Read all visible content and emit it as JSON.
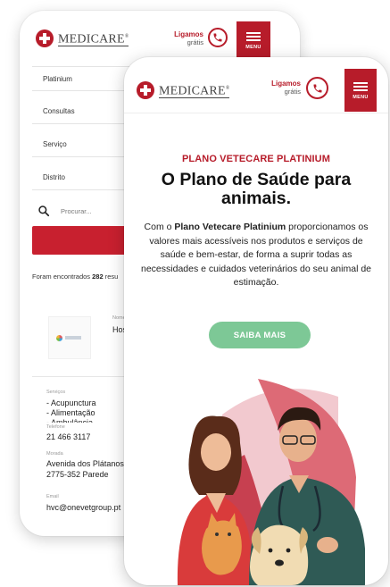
{
  "colors": {
    "brand_red": "#b71c2a",
    "cta_green": "#7dc896"
  },
  "brand": {
    "name": "MEDICARE",
    "trademark": "®"
  },
  "call": {
    "line1": "Ligamos",
    "line2": "grátis"
  },
  "menu": {
    "label": "MENU"
  },
  "back_screen": {
    "filters": [
      "Platinium",
      "Consultas",
      "Serviço",
      "Distrito"
    ],
    "search_placeholder": "Procurar...",
    "found_prefix": "Foram encontrados",
    "found_count": "282",
    "found_suffix": "resu",
    "result": {
      "name_label": "Nome",
      "name_value": "Hosp",
      "services_label": "Serviços",
      "services": [
        "- Acupunctura",
        "- Alimentação",
        "- Ambulância"
      ],
      "phone_label": "Telefone",
      "phone_value": "21 466 3117",
      "address_label": "Morada",
      "address_line1": "Avenida dos Plátanos",
      "address_line2": "2775-352 Parede",
      "email_label": "Email",
      "email_value": "hvc@onevetgroup.pt"
    }
  },
  "front_screen": {
    "kicker": "PLANO VETECARE PLATINIUM",
    "headline_line1": "O Plano de Saúde para",
    "headline_line2": "animais.",
    "body_prefix": "Com o ",
    "body_bold": "Plano Vetecare Platinium",
    "body_rest": " proporcionamos os valores mais acessíveis nos produtos e serviços de saúde e bem-estar, de forma a suprir todas as necessidades e cuidados veterinários do seu animal de estimação.",
    "cta_label": "SAIBA MAIS"
  }
}
